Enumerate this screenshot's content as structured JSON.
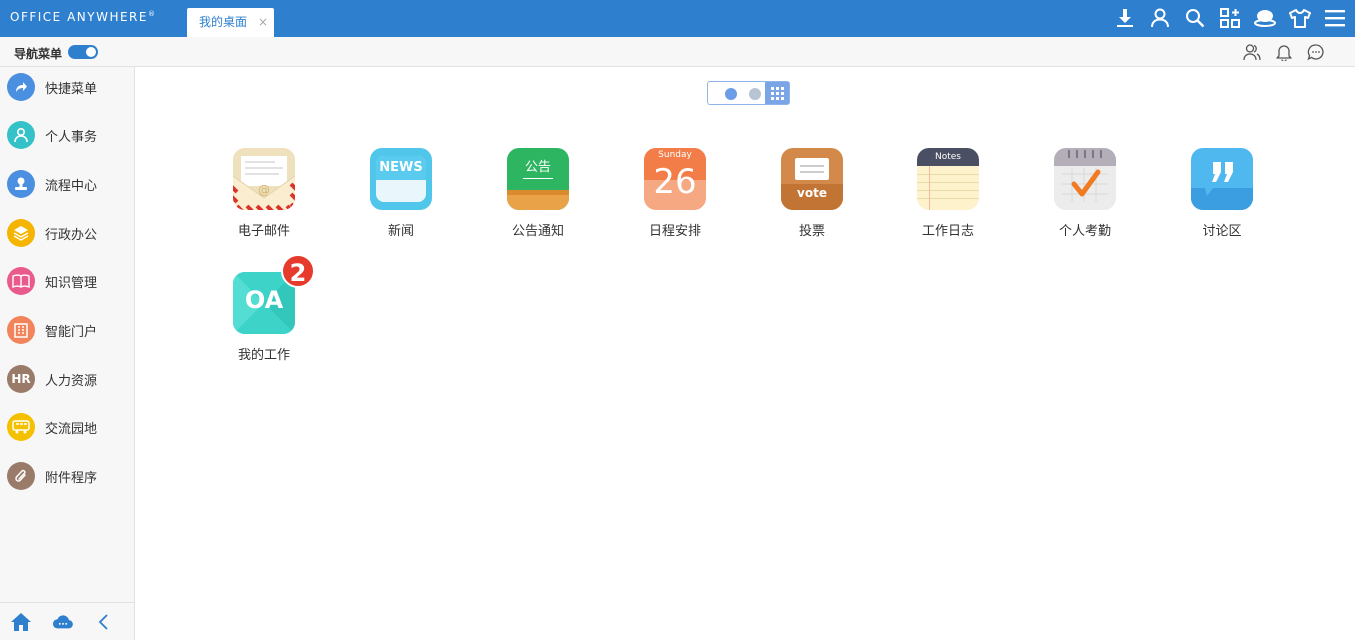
{
  "app": {
    "logo_text": "Office Anywhere",
    "logo_mark": "®",
    "active_tab": "我的桌面",
    "tab_close": "×"
  },
  "top_icons": [
    "download-icon",
    "user-icon",
    "search-icon",
    "apps-icon",
    "skin-icon",
    "shirt-icon",
    "menu-icon"
  ],
  "subbar": {
    "nav_label": "导航菜单",
    "nav_toggle_on": true,
    "icons": [
      "contacts-icon",
      "bell-icon",
      "chat-icon"
    ]
  },
  "sidebar": {
    "items": [
      {
        "label": "快捷菜单",
        "icon": "share-icon",
        "color": "#4a8fe0"
      },
      {
        "label": "个人事务",
        "icon": "person-icon",
        "color": "#35c1c8"
      },
      {
        "label": "流程中心",
        "icon": "stamp-icon",
        "color": "#4a8fe0"
      },
      {
        "label": "行政办公",
        "icon": "layers-icon",
        "color": "#f4b400"
      },
      {
        "label": "知识管理",
        "icon": "book-icon",
        "color": "#e95b8c"
      },
      {
        "label": "智能门户",
        "icon": "building-icon",
        "color": "#f2845c"
      },
      {
        "label": "人力资源",
        "icon": "hr-icon",
        "color": "#9a7b6a",
        "text": "HR"
      },
      {
        "label": "交流园地",
        "icon": "bus-icon",
        "color": "#f4c000"
      },
      {
        "label": "附件程序",
        "icon": "paperclip-icon",
        "color": "#9a7b6a"
      }
    ],
    "footer_icons": [
      "home-icon",
      "cloud-icon",
      "collapse-icon"
    ]
  },
  "desktop": {
    "apps": [
      {
        "label": "电子邮件",
        "icon": "mail-icon"
      },
      {
        "label": "新闻",
        "icon": "news-icon",
        "icon_text": "NEWS"
      },
      {
        "label": "公告通知",
        "icon": "notice-board-icon",
        "icon_text": "公告"
      },
      {
        "label": "日程安排",
        "icon": "calendar-icon",
        "icon_top": "Sunday",
        "icon_text": "26"
      },
      {
        "label": "投票",
        "icon": "vote-box-icon",
        "icon_text": "vote"
      },
      {
        "label": "工作日志",
        "icon": "notes-icon",
        "icon_text": "Notes"
      },
      {
        "label": "个人考勤",
        "icon": "attendance-icon"
      },
      {
        "label": "讨论区",
        "icon": "quote-bubble-icon"
      },
      {
        "label": "我的工作",
        "icon": "oa-icon",
        "icon_text": "OA",
        "badge": "2"
      }
    ]
  }
}
